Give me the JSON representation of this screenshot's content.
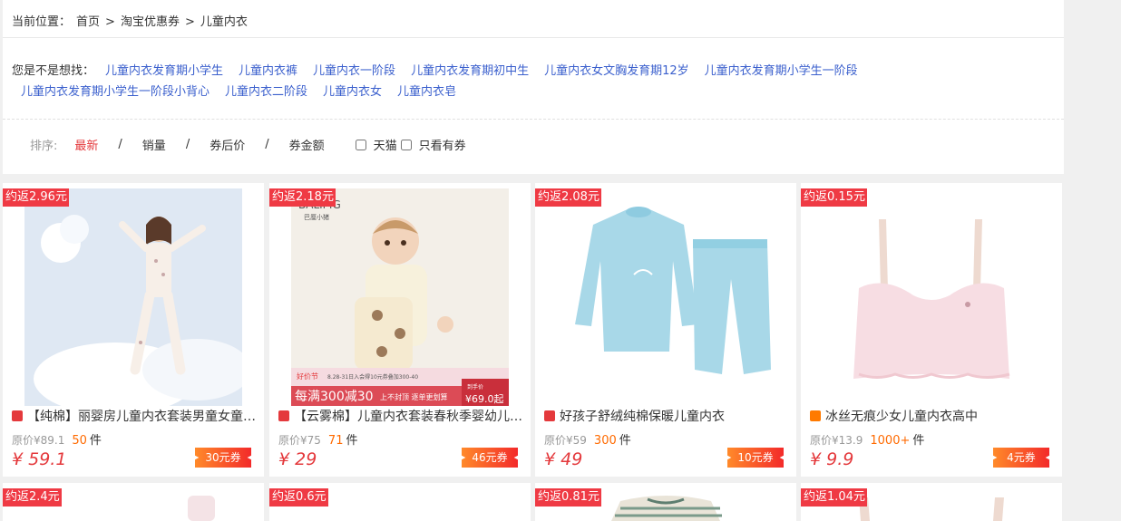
{
  "breadcrumb": {
    "label": "当前位置：",
    "items": [
      "首页",
      "淘宝优惠券",
      "儿童内衣"
    ],
    "separator": ">"
  },
  "suggestions": {
    "label": "您是不是想找：",
    "row1": [
      "儿童内衣发育期小学生",
      "儿童内衣裤",
      "儿童内衣一阶段",
      "儿童内衣发育期初中生",
      "儿童内衣女文胸发育期12岁",
      "儿童内衣发育期小学生一阶段"
    ],
    "row2": [
      "儿童内衣发育期小学生一阶段小背心",
      "儿童内衣二阶段",
      "儿童内衣女",
      "儿童内衣皂"
    ]
  },
  "sort": {
    "label": "排序:",
    "options": [
      "最新",
      "销量",
      "券后价",
      "券金额"
    ],
    "separator": "/",
    "filters": [
      "天猫",
      "只看有券"
    ]
  },
  "colors": {
    "accent": "#e4393c",
    "link": "#3a5fcd",
    "sales": "#ff6a00",
    "badge": "#ef3a44",
    "tmall": "#e4393c",
    "taobao": "#ff7a00"
  },
  "products": [
    {
      "rebate": "约返2.96元",
      "title": "【纯棉】丽婴房儿童内衣套装男童女童秋衣秋裤",
      "shop_icon": "tmall-icon",
      "orig_label": "原价",
      "orig_price": "¥89.1",
      "sales": "50",
      "sales_unit": "件",
      "price": "¥ 59.1",
      "coupon": "30元券",
      "image": "girl-pajamas"
    },
    {
      "rebate": "约返2.18元",
      "title": "【云雾棉】儿童内衣套装春秋季婴幼儿秋衣秋裤",
      "shop_icon": "tmall-icon",
      "orig_label": "原价",
      "orig_price": "¥75",
      "sales": "71",
      "sales_unit": "件",
      "price": "¥ 29",
      "coupon": "46元券",
      "image": "baby-romper",
      "image_text": {
        "brand": "BALIPIG",
        "brand_cn": "巴厘小猪",
        "promo_tag": "好价节",
        "promo_date": "8.28-31日入会得10元券叠加300-40",
        "promo_main": "每满300减30",
        "promo_sub": "上不封顶 逐单更划算",
        "promo_price_label": "到手价",
        "promo_price": "¥69.0起"
      }
    },
    {
      "rebate": "约返2.08元",
      "title": "好孩子舒绒纯棉保暖儿童内衣",
      "shop_icon": "tmall-icon",
      "orig_label": "原价",
      "orig_price": "¥59",
      "sales": "300",
      "sales_unit": "件",
      "price": "¥ 49",
      "coupon": "10元券",
      "image": "blue-set"
    },
    {
      "rebate": "约返0.15元",
      "title": "冰丝无痕少女儿童内衣高中",
      "shop_icon": "taobao-icon",
      "orig_label": "原价",
      "orig_price": "¥13.9",
      "sales": "1000+",
      "sales_unit": "件",
      "price": "¥ 9.9",
      "coupon": "4元券",
      "image": "pink-bra"
    },
    {
      "rebate": "约返2.4元"
    },
    {
      "rebate": "约返0.6元"
    },
    {
      "rebate": "约返0.81元"
    },
    {
      "rebate": "约返1.04元"
    }
  ]
}
